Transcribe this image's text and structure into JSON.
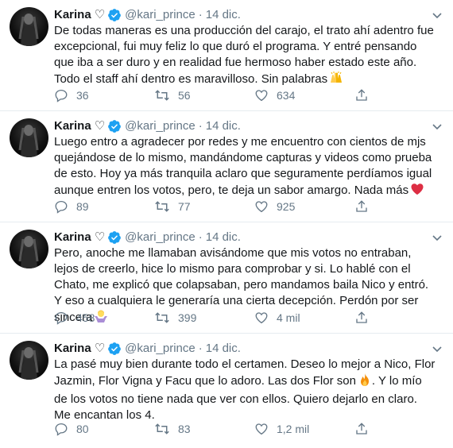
{
  "tweets": [
    {
      "name": "Karina",
      "name_suffix": "♡",
      "handle": "@kari_prince",
      "separator": "·",
      "date": "14 dic.",
      "text": "De todas maneras es una producción del carajo, el trato ahí adentro fue excepcional, fui muy feliz lo que duró el programa. Y entré pensando que iba a ser duro y en realidad fue hermoso haber estado este año. Todo el staff ahí dentro es maravilloso. Sin palabras",
      "emoji": "raising-hands-icon",
      "replies": "36",
      "retweets": "56",
      "likes": "634"
    },
    {
      "name": "Karina",
      "name_suffix": "♡",
      "handle": "@kari_prince",
      "separator": "·",
      "date": "14 dic.",
      "text": "Luego entro a agradecer por redes y me encuentro con cientos de mjs quejándose de lo mismo, mandándome capturas y videos como prueba de esto. Hoy ya más tranquila aclaro que seguramente perdíamos igual aunque entren los votos, pero, te deja un sabor amargo.  Nada más",
      "emoji": "red-heart-icon",
      "replies": "89",
      "retweets": "77",
      "likes": "925"
    },
    {
      "name": "Karina",
      "name_suffix": "♡",
      "handle": "@kari_prince",
      "separator": "·",
      "date": "14 dic.",
      "text": "Pero, anoche me llamaban avisándome que mis votos no entraban, lejos de creerlo, hice lo mismo para comprobar y si. Lo hablé con el Chato, me explicó que colapsaban, pero mandamos baila Nico y entró. Y eso a cualquiera le generaría una cierta decepción. Perdón por ser sincera",
      "emoji": "woman-shrugging-icon",
      "replies": "458",
      "retweets": "399",
      "likes": "4 mil"
    },
    {
      "name": "Karina",
      "name_suffix": "♡",
      "handle": "@kari_prince",
      "separator": "·",
      "date": "14 dic.",
      "text_before": "La pasé muy bien durante todo el certamen. Deseo lo mejor a Nico, Flor Jazmin, Flor Vigna y Facu que lo adoro. Las dos Flor son",
      "text_after": ". Y lo mío de los votos no tiene nada que ver con ellos. Quiero dejarlo en claro. Me encantan los 4.",
      "emoji": "fire-icon",
      "replies": "80",
      "retweets": "83",
      "likes": "1,2 mil"
    }
  ],
  "colors": {
    "text": "#14171a",
    "muted": "#657786",
    "verified": "#1da1f2",
    "divider": "#e6ecf0"
  }
}
